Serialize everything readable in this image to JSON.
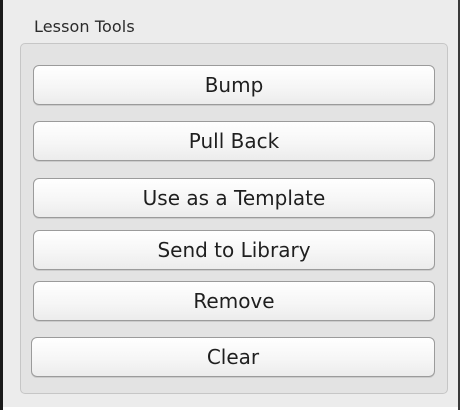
{
  "panel": {
    "title": "Lesson Tools"
  },
  "buttons": [
    {
      "label": "Bump"
    },
    {
      "label": "Pull Back"
    },
    {
      "label": "Use as a Template"
    },
    {
      "label": "Send to Library"
    },
    {
      "label": "Remove"
    },
    {
      "label": "Clear"
    }
  ]
}
